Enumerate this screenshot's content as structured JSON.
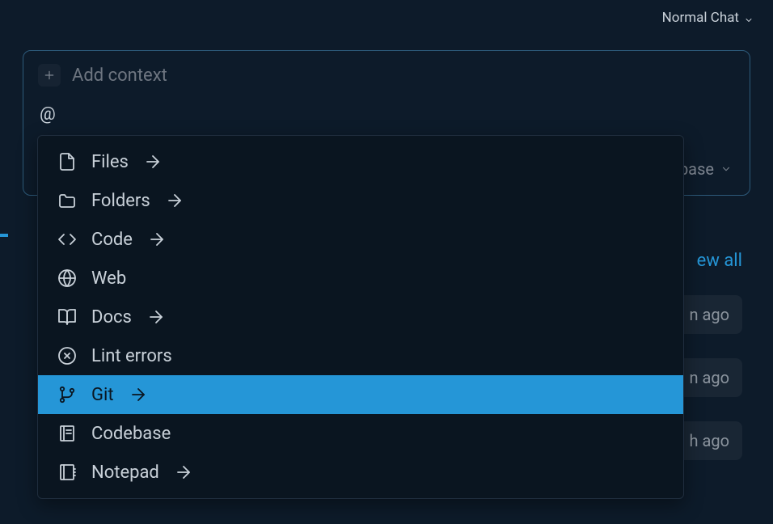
{
  "header": {
    "mode_label": "Normal Chat"
  },
  "context_panel": {
    "add_context_label": "Add context",
    "input_value": "@",
    "codebase_label": "base"
  },
  "dropdown": {
    "items": [
      {
        "label": "Files",
        "icon": "file-icon",
        "has_arrow": true,
        "selected": false
      },
      {
        "label": "Folders",
        "icon": "folder-icon",
        "has_arrow": true,
        "selected": false
      },
      {
        "label": "Code",
        "icon": "code-icon",
        "has_arrow": true,
        "selected": false
      },
      {
        "label": "Web",
        "icon": "globe-icon",
        "has_arrow": false,
        "selected": false
      },
      {
        "label": "Docs",
        "icon": "book-icon",
        "has_arrow": true,
        "selected": false
      },
      {
        "label": "Lint errors",
        "icon": "error-icon",
        "has_arrow": false,
        "selected": false
      },
      {
        "label": "Git",
        "icon": "git-icon",
        "has_arrow": true,
        "selected": true
      },
      {
        "label": "Codebase",
        "icon": "codebase-icon",
        "has_arrow": false,
        "selected": false
      },
      {
        "label": "Notepad",
        "icon": "notepad-icon",
        "has_arrow": true,
        "selected": false
      }
    ]
  },
  "background": {
    "view_all": "ew all",
    "badges": [
      "n ago",
      "n ago",
      "h ago"
    ]
  }
}
